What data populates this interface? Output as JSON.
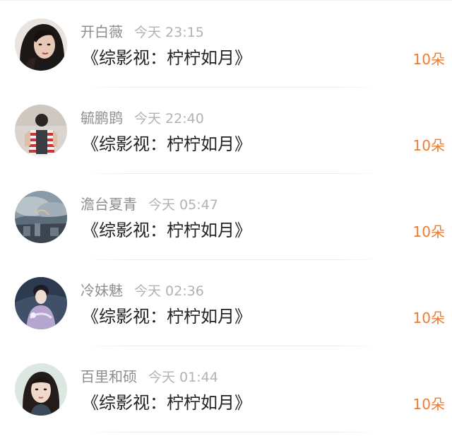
{
  "gift_list": {
    "items": [
      {
        "name": "开白薇",
        "time": "今天 23:15",
        "title": "《综影视：柠柠如月》",
        "amount": "10朵",
        "avatar_icon": "portrait-dark-hair-avatar-icon"
      },
      {
        "name": "毓鹏鹍",
        "time": "今天 22:40",
        "title": "《综影视：柠柠如月》",
        "amount": "10朵",
        "avatar_icon": "person-striped-shirt-avatar-icon"
      },
      {
        "name": "澹台夏青",
        "time": "今天 05:47",
        "title": "《综影视：柠柠如月》",
        "amount": "10朵",
        "avatar_icon": "cloudy-landscape-avatar-icon"
      },
      {
        "name": "冷妹魅",
        "time": "今天 02:36",
        "title": "《综影视：柠柠如月》",
        "amount": "10朵",
        "avatar_icon": "costume-woman-avatar-icon"
      },
      {
        "name": "百里和硕",
        "time": "今天 01:44",
        "title": "《综影视：柠柠如月》",
        "amount": "10朵",
        "avatar_icon": "portrait-woman-avatar-icon"
      }
    ]
  },
  "colors": {
    "name": "#8e8e8e",
    "time": "#b2b2b2",
    "title": "#222222",
    "amount_accent": "#f07a2e"
  }
}
